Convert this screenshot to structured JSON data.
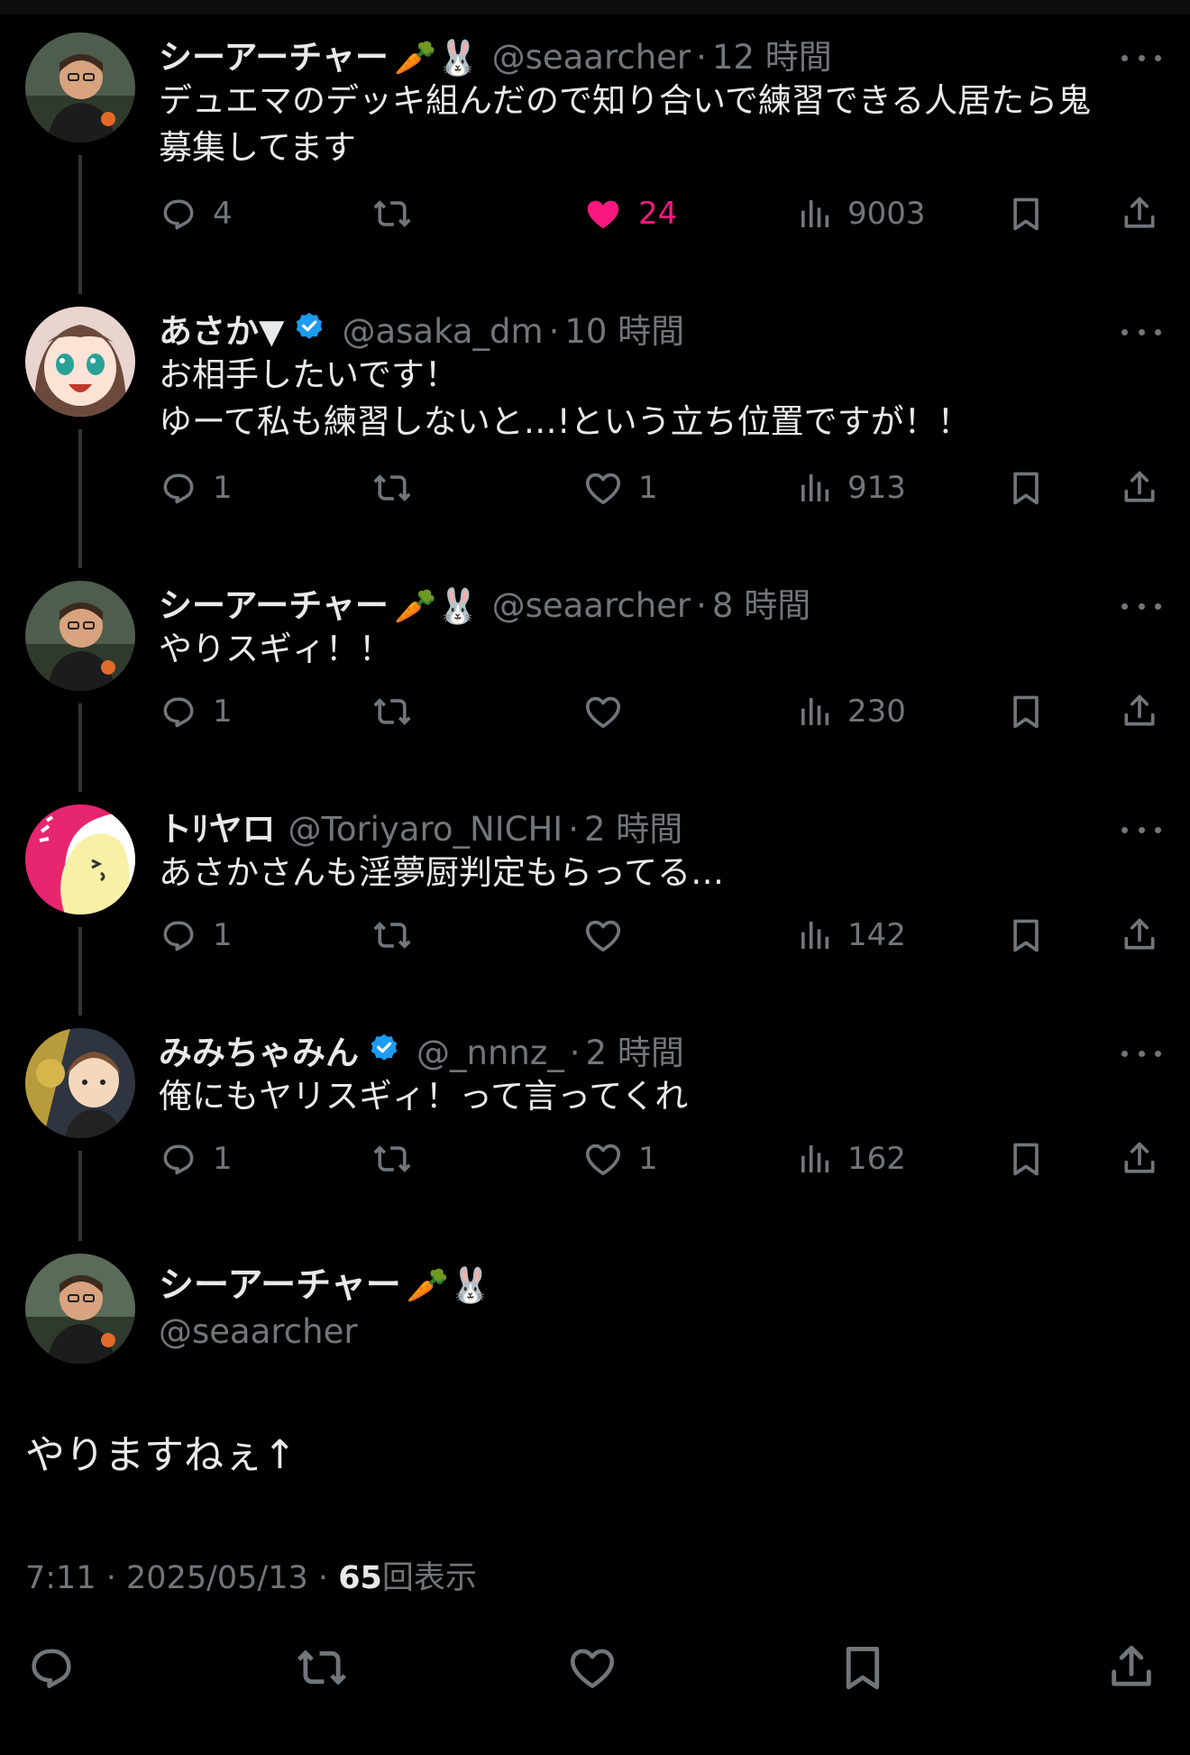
{
  "replies": [
    {
      "name": "シーアーチャー",
      "name_deco": "🥕🐰",
      "verified": false,
      "handle": "@seaarcher",
      "time": "12 時間",
      "text": "デュエマのデッキ組んだので知り合いで練習できる人居たら鬼\n募集してます",
      "replies": "4",
      "retweets": "",
      "likes": "24",
      "liked": true,
      "views": "9003"
    },
    {
      "name": "あさか▼",
      "name_deco": "",
      "verified": true,
      "handle": "@asaka_dm",
      "time": "10 時間",
      "text": "お相手したいです！\nゆーて私も練習しないと…!という立ち位置ですが！！",
      "replies": "1",
      "retweets": "",
      "likes": "1",
      "liked": false,
      "views": "913"
    },
    {
      "name": "シーアーチャー",
      "name_deco": "🥕🐰",
      "verified": false,
      "handle": "@seaarcher",
      "time": "8 時間",
      "text": "やりスギィ！！",
      "replies": "1",
      "retweets": "",
      "likes": "",
      "liked": false,
      "views": "230"
    },
    {
      "name": "トﾘヤロ",
      "name_deco": "",
      "verified": false,
      "handle": "@Toriyaro_NICHI",
      "time": "2 時間",
      "text": "あさかさんも淫夢厨判定もらってる…",
      "replies": "1",
      "retweets": "",
      "likes": "",
      "liked": false,
      "views": "142"
    },
    {
      "name": "みみちゃみん",
      "name_deco": "",
      "verified": true,
      "handle": "@_nnnz_",
      "time": "2 時間",
      "text": "俺にもヤリスギィ！って言ってくれ",
      "replies": "1",
      "retweets": "",
      "likes": "1",
      "liked": false,
      "views": "162"
    }
  ],
  "main_post": {
    "name": "シーアーチャー",
    "name_deco": "🥕🐰",
    "handle": "@seaarcher",
    "text": "やりますねぇ↑",
    "time": "7:11",
    "date": "2025/05/13",
    "separator": "·",
    "views_count": "65",
    "views_label": "回表示"
  },
  "icons": {
    "reply": "reply-icon",
    "retweet": "retweet-icon",
    "like": "heart-icon",
    "views": "views-icon",
    "bookmark": "bookmark-icon",
    "share": "share-icon",
    "verified": "verified-badge-icon",
    "more": "more-icon"
  },
  "colors": {
    "background": "#000000",
    "text": "#e7e9ea",
    "muted": "#71767b",
    "like": "#f91880",
    "verified": "#1d9bf0",
    "thread_line": "#333639"
  }
}
